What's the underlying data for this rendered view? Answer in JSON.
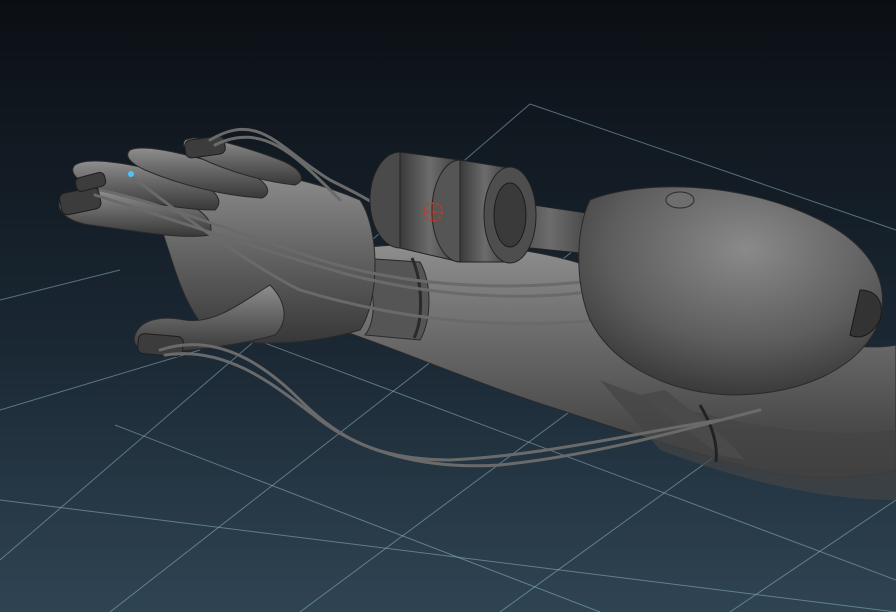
{
  "viewport": {
    "background_top": "#0b0f14",
    "background_bottom": "#2c3e4e",
    "grid_color": "#8fb3c0",
    "grid_highlight_color": "#9fd6d8",
    "model_color": "#5f5f5f",
    "model_shadow": "#2f2f2f",
    "model_highlight": "#8c8c8c",
    "pivot_color": "#c0392b",
    "vertex_color": "#4fc3f7"
  },
  "objects": {
    "model": "hand-arm-mesh",
    "gizmo": "pivot-icon",
    "selected_point": "vertex-point-icon"
  }
}
